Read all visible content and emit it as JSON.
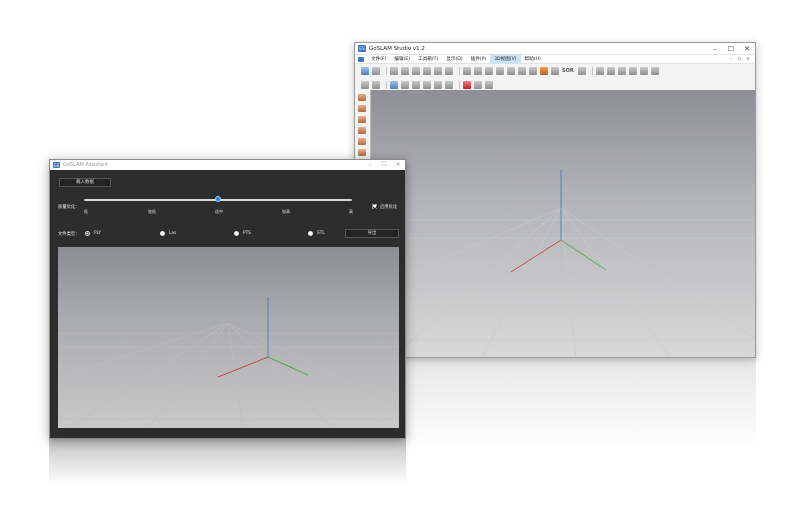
{
  "studio": {
    "title": "GoSLAM Studio v1.2",
    "app_icon_text": "GS",
    "window_controls": [
      "–",
      "☐",
      "✕"
    ],
    "menu": [
      {
        "label": "文件(F)",
        "active": false
      },
      {
        "label": "编辑(E)",
        "active": false
      },
      {
        "label": "工具箱(T)",
        "active": false
      },
      {
        "label": "显示(D)",
        "active": false
      },
      {
        "label": "插件(P)",
        "active": false
      },
      {
        "label": "3D视图(V)",
        "active": true
      },
      {
        "label": "帮助(H)",
        "active": false
      }
    ],
    "mdi_controls": "– ▫ ×",
    "toolbar_text": "SOR"
  },
  "assistant": {
    "title": "GoSLAM Assistant",
    "app_icon_text": "GS",
    "window_controls": [
      "–",
      "☐",
      "✕"
    ],
    "load_button": "载入数据",
    "quality_label": "质量优化：",
    "quality_levels": [
      "低",
      "较低",
      "适中",
      "较高",
      "高"
    ],
    "quality_value_index": 2,
    "ai_optimize_label": "启用优化",
    "ai_optimize_checked": true,
    "filetype_label": "文件类型：",
    "filetypes": [
      {
        "label": "PLY",
        "checked": true
      },
      {
        "label": "Las",
        "checked": false
      },
      {
        "label": "PTS",
        "checked": false
      },
      {
        "label": "STL",
        "checked": false
      }
    ],
    "export_button": "导出"
  },
  "colors": {
    "accent": "#2f86d6",
    "assistant_bg": "#2d2d2d",
    "axis_x": "#c03030",
    "axis_y": "#40a040",
    "axis_z": "#4060d0"
  },
  "icons": {
    "app": "gs-logo-icon",
    "toolbar": [
      "open-icon",
      "save-icon",
      "select-icon",
      "move-icon",
      "rotate-icon",
      "scale-icon",
      "delete-icon",
      "merge-icon",
      "filter-icon",
      "sor-icon",
      "measure-icon",
      "add-icon",
      "list-icon"
    ],
    "left_rail": [
      "layer-icon",
      "layer-icon",
      "layer-icon",
      "layer-icon",
      "layer-icon",
      "layer-icon"
    ]
  }
}
